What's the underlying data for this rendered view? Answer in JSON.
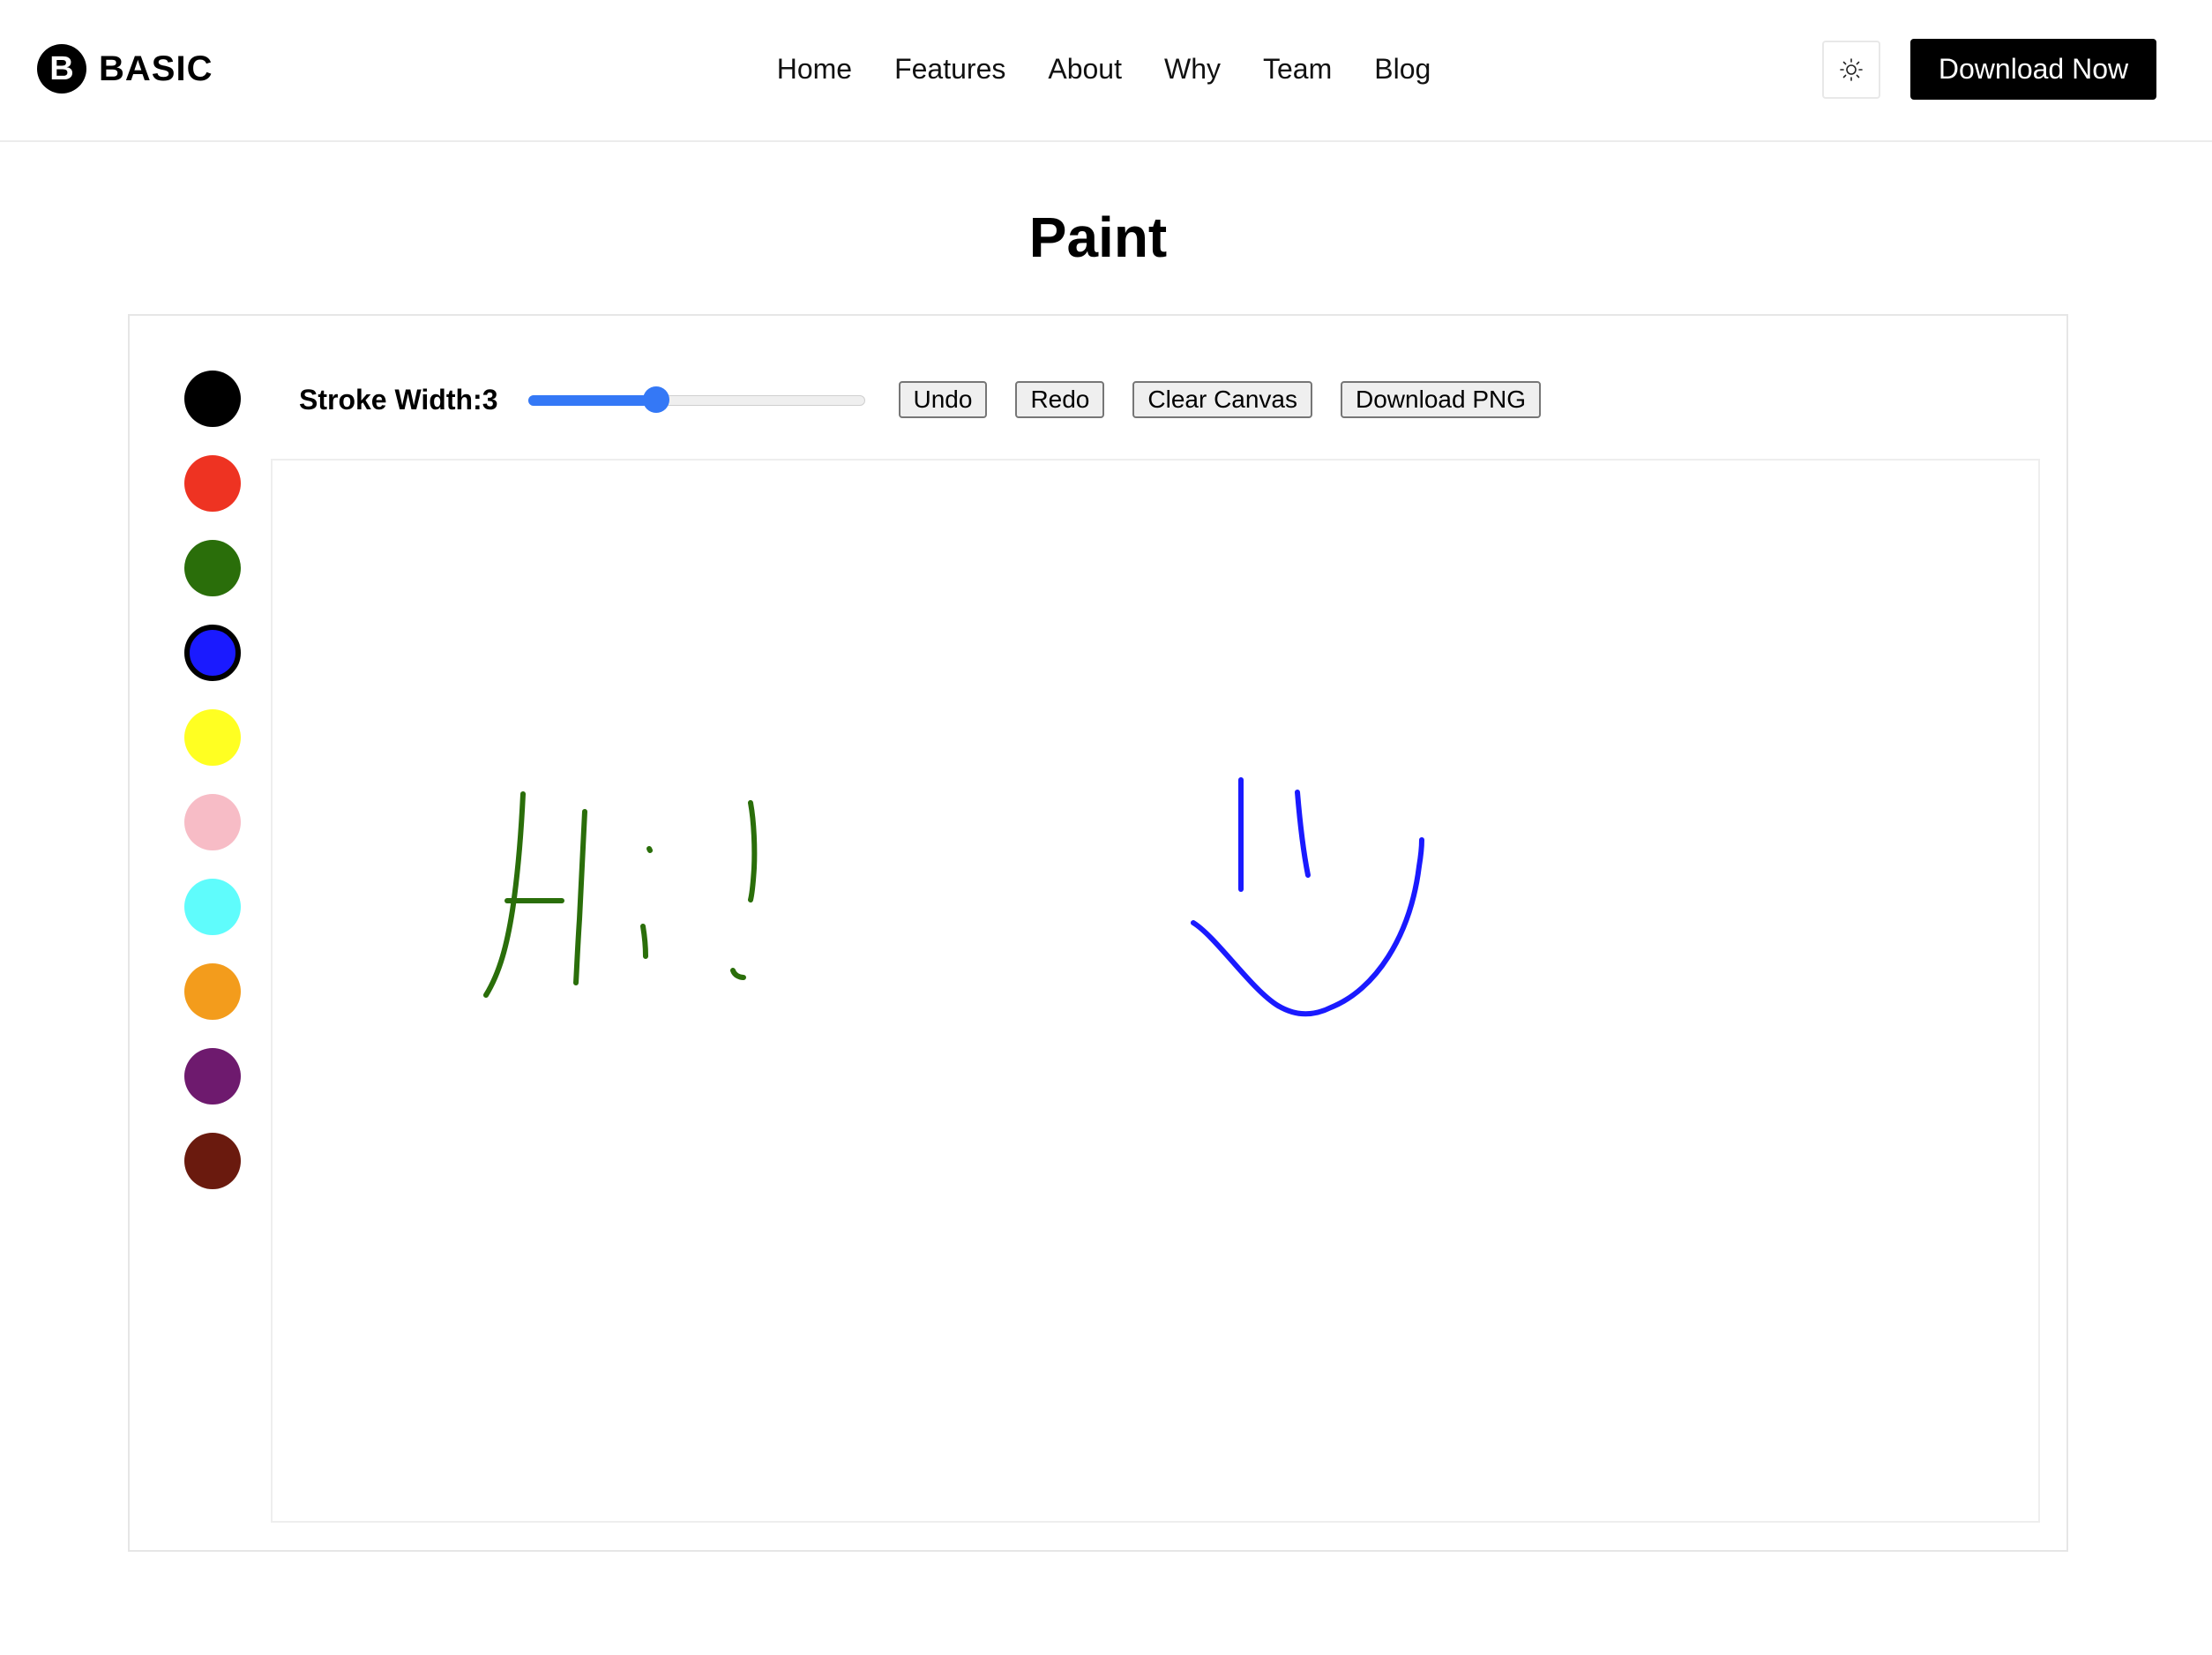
{
  "brand": {
    "logo_letter": "B",
    "name": "BASIC"
  },
  "nav": {
    "items": [
      {
        "label": "Home"
      },
      {
        "label": "Features"
      },
      {
        "label": "About"
      },
      {
        "label": "Why"
      },
      {
        "label": "Team"
      },
      {
        "label": "Blog"
      }
    ]
  },
  "header": {
    "theme_toggle_icon": "sun-icon",
    "download_label": "Download Now"
  },
  "page": {
    "title": "Paint"
  },
  "palette": {
    "selected_index": 3,
    "colors": [
      "#000000",
      "#ee3322",
      "#2a6e0a",
      "#1a1aff",
      "#ffff22",
      "#f7bcc6",
      "#5ffcfc",
      "#f39c1c",
      "#6e1a6e",
      "#6a1a0e"
    ]
  },
  "toolbar": {
    "stroke_label": "Stroke Width:3",
    "stroke_value": 3,
    "stroke_min": 1,
    "stroke_max": 10,
    "undo_label": "Undo",
    "redo_label": "Redo",
    "clear_label": "Clear Canvas",
    "download_png_label": "Download PNG"
  },
  "drawing": {
    "greeting_color": "#2a6e0a",
    "smiley_color": "#1a1aff"
  }
}
